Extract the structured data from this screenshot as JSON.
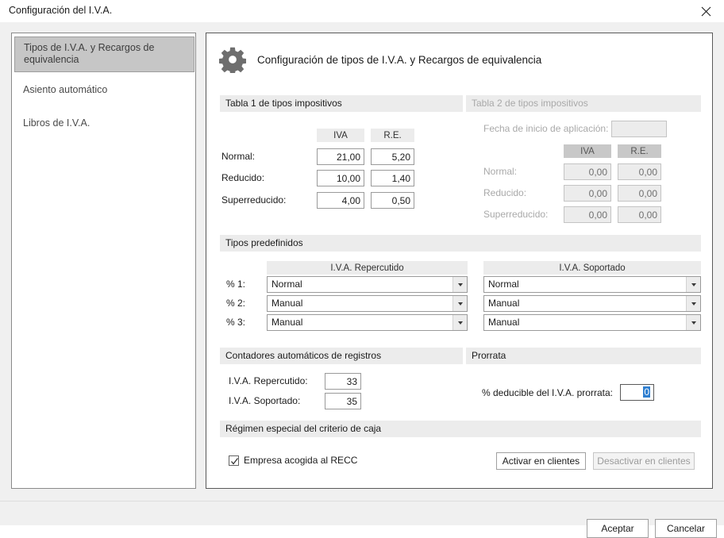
{
  "window": {
    "title": "Configuración del I.V.A.",
    "close_icon": "close-icon"
  },
  "sidebar": {
    "items": [
      {
        "label": "Tipos de I.V.A. y Recargos de equivalencia",
        "selected": true
      },
      {
        "label": "Asiento automático",
        "selected": false
      },
      {
        "label": "Libros de I.V.A.",
        "selected": false
      }
    ]
  },
  "content": {
    "icon": "gear-icon",
    "title": "Configuración de tipos de I.V.A. y Recargos de equivalencia",
    "table1": {
      "header": "Tabla 1 de tipos impositivos",
      "col_iva": "IVA",
      "col_re": "R.E.",
      "rows": [
        {
          "label": "Normal:",
          "iva": "21,00",
          "re": "5,20"
        },
        {
          "label": "Reducido:",
          "iva": "10,00",
          "re": "1,40"
        },
        {
          "label": "Superreducido:",
          "iva": "4,00",
          "re": "0,50"
        }
      ]
    },
    "table2": {
      "header": "Tabla 2 de tipos impositivos",
      "date_label": "Fecha de inicio de aplicación:",
      "date_value": "",
      "col_iva": "IVA",
      "col_re": "R.E.",
      "rows": [
        {
          "label": "Normal:",
          "iva": "0,00",
          "re": "0,00"
        },
        {
          "label": "Reducido:",
          "iva": "0,00",
          "re": "0,00"
        },
        {
          "label": "Superreducido:",
          "iva": "0,00",
          "re": "0,00"
        }
      ]
    },
    "predefined": {
      "header": "Tipos predefinidos",
      "col_repercutido": "I.V.A. Repercutido",
      "col_soportado": "I.V.A. Soportado",
      "rows": [
        {
          "label": "% 1:",
          "repercutido": "Normal",
          "soportado": "Normal"
        },
        {
          "label": "% 2:",
          "repercutido": "Manual",
          "soportado": "Manual"
        },
        {
          "label": "% 3:",
          "repercutido": "Manual",
          "soportado": "Manual"
        }
      ]
    },
    "counters": {
      "header": "Contadores automáticos de registros",
      "rows": [
        {
          "label": "I.V.A. Repercutido:",
          "value": "33"
        },
        {
          "label": "I.V.A. Soportado:",
          "value": "35"
        }
      ]
    },
    "prorrata": {
      "header": "Prorrata",
      "label": "% deducible del I.V.A. prorrata:",
      "value": "0",
      "selected": true
    },
    "recc": {
      "header": "Régimen especial del criterio de caja",
      "checkbox_label": "Empresa acogida al RECC",
      "checked": true,
      "activate_label": "Activar en clientes",
      "deactivate_label": "Desactivar en clientes",
      "deactivate_disabled": true
    }
  },
  "footer": {
    "accept_label": "Aceptar",
    "cancel_label": "Cancelar"
  },
  "colors": {
    "band": "#ececec",
    "selection": "#2f7fd0",
    "disabled_text": "#a9a9a9"
  }
}
